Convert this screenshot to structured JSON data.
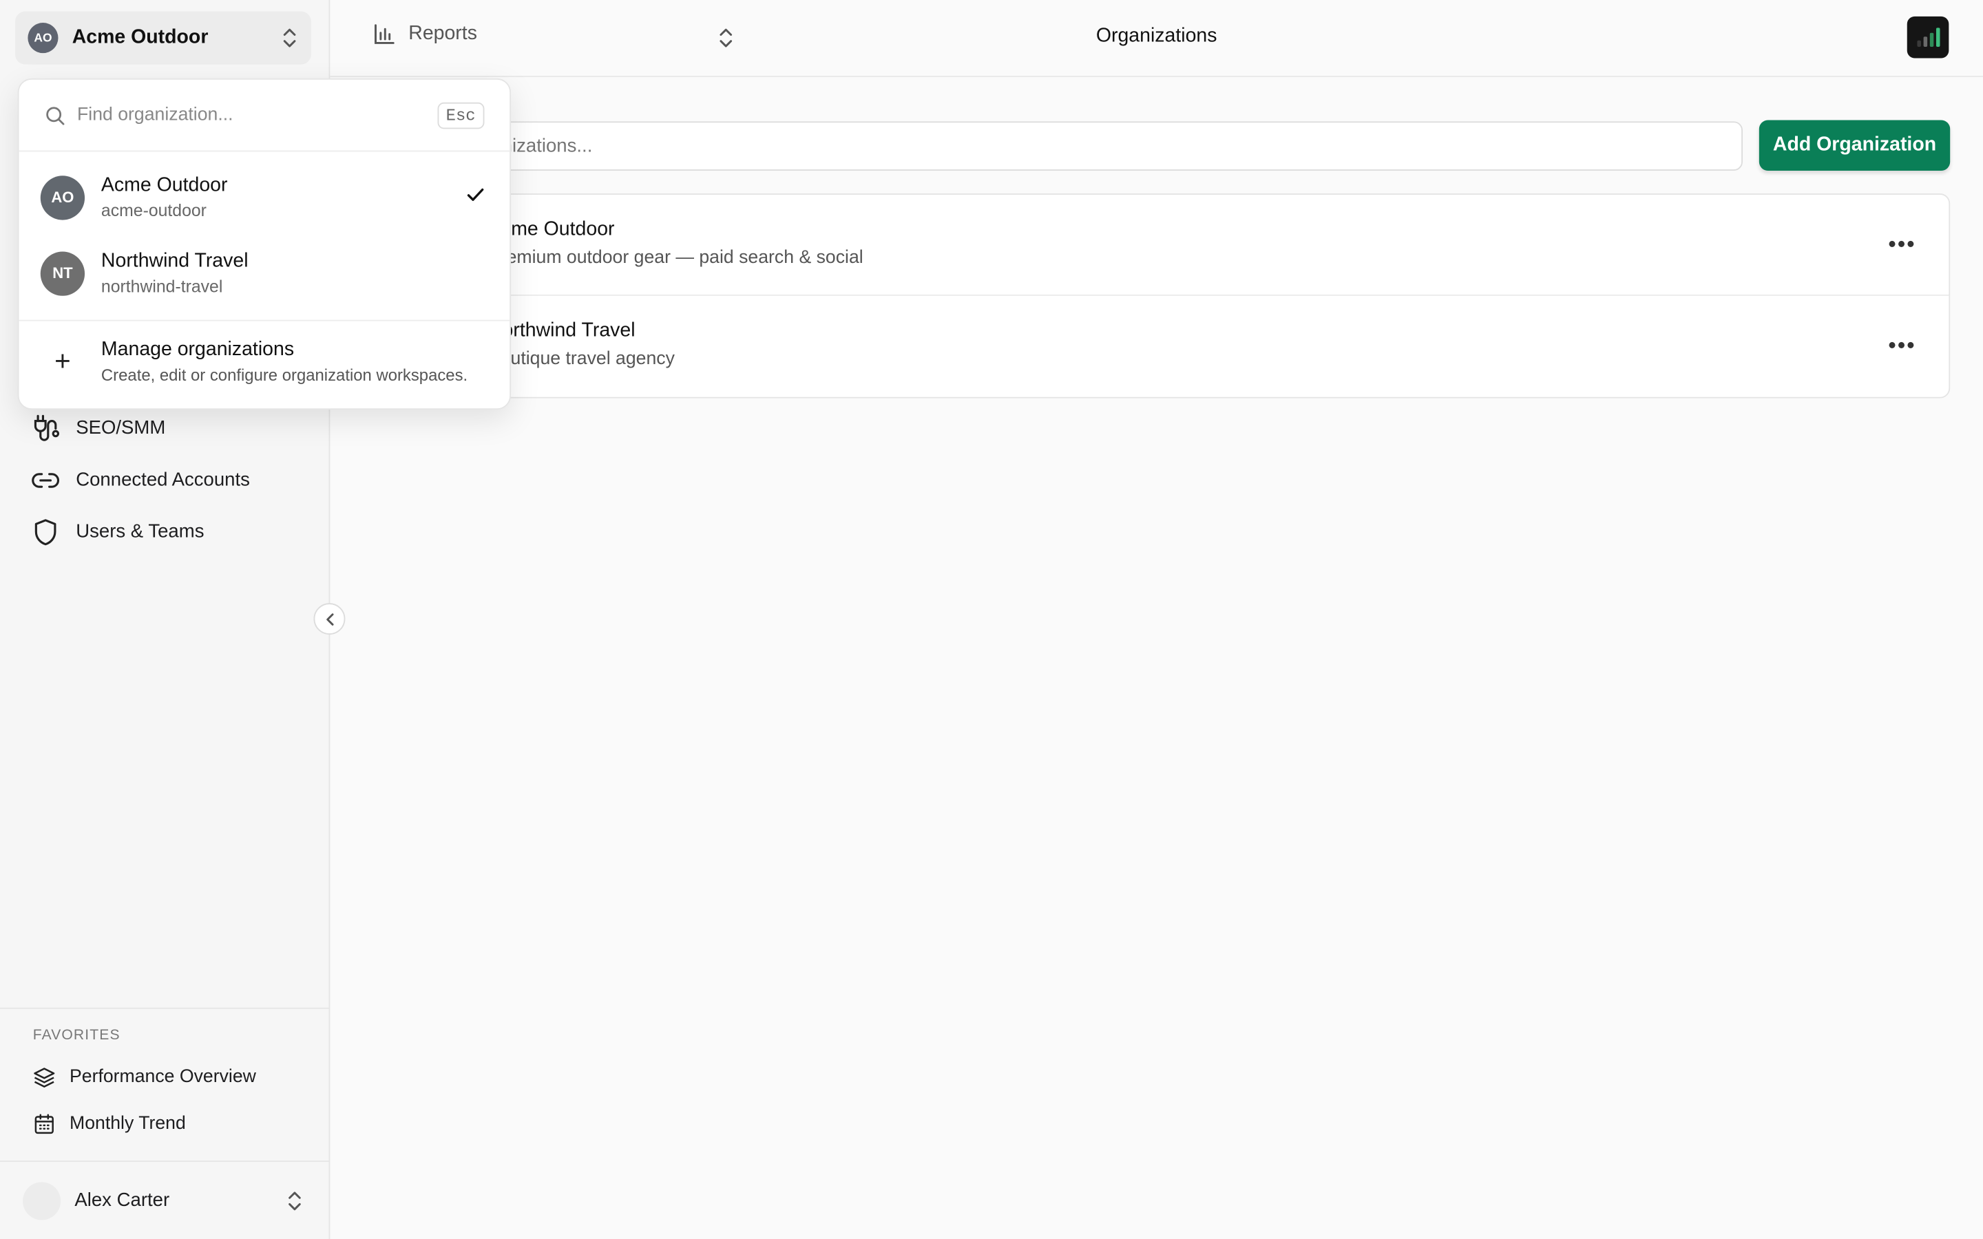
{
  "sidebar": {
    "current_org": {
      "initials": "AO",
      "name": "Acme Outdoor"
    },
    "nav": [
      {
        "label": "SEO/SMM",
        "icon": "plug-icon"
      },
      {
        "label": "Connected Accounts",
        "icon": "link-icon"
      },
      {
        "label": "Users & Teams",
        "icon": "shield-icon"
      }
    ],
    "favorites": {
      "heading": "FAVORITES",
      "items": [
        {
          "label": "Performance Overview",
          "icon": "layers-icon"
        },
        {
          "label": "Monthly Trend",
          "icon": "calendar-icon"
        }
      ]
    },
    "user": {
      "name": "Alex Carter"
    }
  },
  "topbar": {
    "report_selector": "Reports",
    "title": "Organizations"
  },
  "main": {
    "search_placeholder": "Search organizations...",
    "add_button": "Add Organization",
    "organizations": [
      {
        "name": "Acme Outdoor",
        "description": "Premium outdoor gear — paid search & social"
      },
      {
        "name": "Northwind Travel",
        "description": "Boutique travel agency"
      }
    ]
  },
  "dropdown": {
    "search_placeholder": "Find organization...",
    "esc_key": "Esc",
    "orgs": [
      {
        "initials": "AO",
        "name": "Acme Outdoor",
        "slug": "acme-outdoor",
        "selected": true
      },
      {
        "initials": "NT",
        "name": "Northwind Travel",
        "slug": "northwind-travel",
        "selected": false
      }
    ],
    "manage": {
      "title": "Manage organizations",
      "subtitle": "Create, edit or configure organization workspaces."
    }
  },
  "colors": {
    "accent": "#0a7f57",
    "sidebar_bg": "#f6f6f6",
    "logo_bars": [
      "#3a3a3a",
      "#6a6a6a",
      "#2e8b57",
      "#3fbf7f"
    ]
  }
}
